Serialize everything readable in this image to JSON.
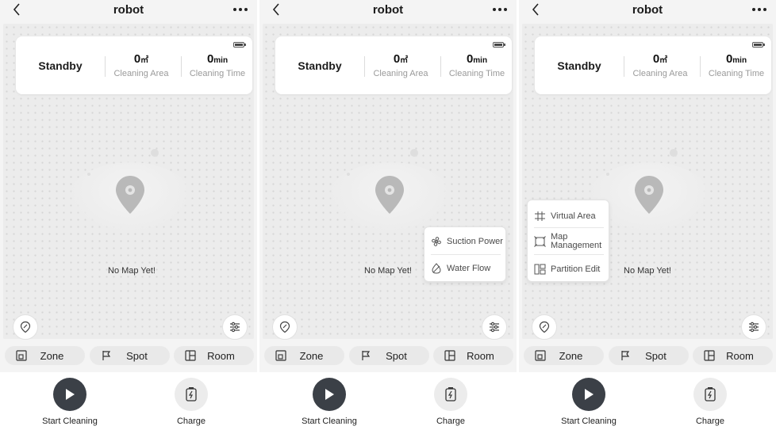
{
  "colors": {
    "dark_button": "#3b4047",
    "map_bg": "#ececec",
    "chip_bg": "#e9e9e9"
  },
  "panels": [
    {
      "title": "robot",
      "status": "Standby",
      "area": {
        "value": "0",
        "unit": "㎡",
        "label": "Cleaning Area"
      },
      "time": {
        "value": "0",
        "unit": "min",
        "label": "Cleaning Time"
      },
      "map_message": "No Map Yet!",
      "popup": null,
      "modes": [
        "Zone",
        "Spot",
        "Room"
      ],
      "actions": {
        "start": "Start Cleaning",
        "charge": "Charge"
      }
    },
    {
      "title": "robot",
      "status": "Standby",
      "area": {
        "value": "0",
        "unit": "㎡",
        "label": "Cleaning Area"
      },
      "time": {
        "value": "0",
        "unit": "min",
        "label": "Cleaning Time"
      },
      "map_message": "No Map Yet!",
      "popup": {
        "type": "settings",
        "items": [
          {
            "label": "Suction Power",
            "icon": "fan-icon"
          },
          {
            "label": "Water Flow",
            "icon": "water-drop-icon"
          }
        ]
      },
      "modes": [
        "Zone",
        "Spot",
        "Room"
      ],
      "actions": {
        "start": "Start Cleaning",
        "charge": "Charge"
      }
    },
    {
      "title": "robot",
      "status": "Standby",
      "area": {
        "value": "0",
        "unit": "㎡",
        "label": "Cleaning Area"
      },
      "time": {
        "value": "0",
        "unit": "min",
        "label": "Cleaning Time"
      },
      "map_message": "No Map Yet!",
      "popup": {
        "type": "map",
        "items": [
          {
            "label": "Virtual Area",
            "icon": "virtual-wall-icon"
          },
          {
            "label": "Map Management",
            "label_lines": [
              "Map",
              "Management"
            ],
            "icon": "map-crop-icon"
          },
          {
            "label": "Partition Edit",
            "icon": "partition-icon"
          }
        ]
      },
      "modes": [
        "Zone",
        "Spot",
        "Room"
      ],
      "actions": {
        "start": "Start Cleaning",
        "charge": "Charge"
      }
    }
  ]
}
